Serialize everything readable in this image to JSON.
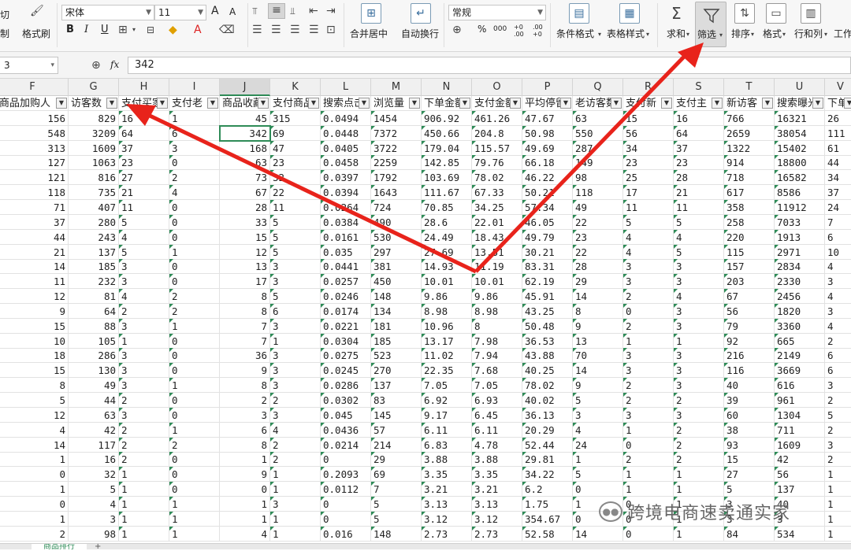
{
  "ribbon": {
    "cut_label": "切",
    "copy_label": "制",
    "format_painter": "格式刷",
    "font_name": "宋体",
    "font_size": "11",
    "number_format": "常规",
    "merge_center": "合并居中",
    "wrap_text": "自动换行",
    "conditional_format": "条件格式",
    "table_style": "表格样式",
    "sum": "求和",
    "filter": "筛选",
    "sort": "排序",
    "format": "格式",
    "row_col": "行和列",
    "work": "工作",
    "bold": "B",
    "italic": "I",
    "underline": "U",
    "font_grow": "A",
    "font_shrink": "A",
    "percent": "%",
    "thousand": "000",
    "inc_dec": "+0 .00",
    "dec_dec": ".00 +0"
  },
  "formula_bar": {
    "name_box": "3",
    "fx": "fx",
    "value": "342"
  },
  "columns": [
    "F",
    "G",
    "H",
    "I",
    "J",
    "K",
    "L",
    "M",
    "N",
    "O",
    "P",
    "Q",
    "R",
    "S",
    "T",
    "U",
    "V"
  ],
  "headers": [
    "商品加购人",
    "访客数",
    "支付买家",
    "支付老",
    "商品收藏",
    "支付商品",
    "搜索点击",
    "浏览量",
    "下单金额",
    "支付金额",
    "平均停留",
    "老访客数",
    "支付新",
    "支付主",
    "新访客",
    "搜索曝光",
    "下单"
  ],
  "rows": [
    [
      "156",
      "829",
      "16",
      "1",
      "45",
      "315",
      "0.0494",
      "1454",
      "906.92",
      "461.26",
      "47.67",
      "63",
      "15",
      "16",
      "766",
      "16321",
      "26"
    ],
    [
      "548",
      "3209",
      "64",
      "6",
      "342",
      "69",
      "0.0448",
      "7372",
      "450.66",
      "204.8",
      "50.98",
      "550",
      "56",
      "64",
      "2659",
      "38054",
      "111"
    ],
    [
      "313",
      "1609",
      "37",
      "3",
      "168",
      "47",
      "0.0405",
      "3722",
      "179.04",
      "115.57",
      "49.69",
      "287",
      "34",
      "37",
      "1322",
      "15402",
      "61"
    ],
    [
      "127",
      "1063",
      "23",
      "0",
      "63",
      "23",
      "0.0458",
      "2259",
      "142.85",
      "79.76",
      "66.18",
      "149",
      "23",
      "23",
      "914",
      "18800",
      "44"
    ],
    [
      "121",
      "816",
      "27",
      "2",
      "73",
      "32",
      "0.0397",
      "1792",
      "103.69",
      "78.02",
      "46.22",
      "98",
      "25",
      "28",
      "718",
      "16582",
      "34"
    ],
    [
      "118",
      "735",
      "21",
      "4",
      "67",
      "22",
      "0.0394",
      "1643",
      "111.67",
      "67.33",
      "50.21",
      "118",
      "17",
      "21",
      "617",
      "8586",
      "37"
    ],
    [
      "71",
      "407",
      "11",
      "0",
      "28",
      "11",
      "0.0264",
      "724",
      "70.85",
      "34.25",
      "57.34",
      "49",
      "11",
      "11",
      "358",
      "11912",
      "24"
    ],
    [
      "37",
      "280",
      "5",
      "0",
      "33",
      "5",
      "0.0384",
      "490",
      "28.6",
      "22.01",
      "46.05",
      "22",
      "5",
      "5",
      "258",
      "7033",
      "7"
    ],
    [
      "44",
      "243",
      "4",
      "0",
      "15",
      "5",
      "0.0161",
      "530",
      "24.49",
      "18.43",
      "49.79",
      "23",
      "4",
      "4",
      "220",
      "1913",
      "6"
    ],
    [
      "21",
      "137",
      "5",
      "1",
      "12",
      "5",
      "0.035",
      "297",
      "27.69",
      "13.51",
      "30.21",
      "22",
      "4",
      "5",
      "115",
      "2971",
      "10"
    ],
    [
      "14",
      "185",
      "3",
      "0",
      "13",
      "3",
      "0.0441",
      "381",
      "14.93",
      "11.19",
      "83.31",
      "28",
      "3",
      "3",
      "157",
      "2834",
      "4"
    ],
    [
      "11",
      "232",
      "3",
      "0",
      "17",
      "3",
      "0.0257",
      "450",
      "10.01",
      "10.01",
      "62.19",
      "29",
      "3",
      "3",
      "203",
      "2330",
      "3"
    ],
    [
      "12",
      "81",
      "4",
      "2",
      "8",
      "5",
      "0.0246",
      "148",
      "9.86",
      "9.86",
      "45.91",
      "14",
      "2",
      "4",
      "67",
      "2456",
      "4"
    ],
    [
      "9",
      "64",
      "2",
      "2",
      "8",
      "6",
      "0.0174",
      "134",
      "8.98",
      "8.98",
      "43.25",
      "8",
      "0",
      "3",
      "56",
      "1820",
      "3"
    ],
    [
      "15",
      "88",
      "3",
      "1",
      "7",
      "3",
      "0.0221",
      "181",
      "10.96",
      "8",
      "50.48",
      "9",
      "2",
      "3",
      "79",
      "3360",
      "4"
    ],
    [
      "10",
      "105",
      "1",
      "0",
      "7",
      "1",
      "0.0304",
      "185",
      "13.17",
      "7.98",
      "36.53",
      "13",
      "1",
      "1",
      "92",
      "665",
      "2"
    ],
    [
      "18",
      "286",
      "3",
      "0",
      "36",
      "3",
      "0.0275",
      "523",
      "11.02",
      "7.94",
      "43.88",
      "70",
      "3",
      "3",
      "216",
      "2149",
      "6"
    ],
    [
      "15",
      "130",
      "3",
      "0",
      "9",
      "3",
      "0.0245",
      "270",
      "22.35",
      "7.68",
      "40.25",
      "14",
      "3",
      "3",
      "116",
      "3669",
      "6"
    ],
    [
      "8",
      "49",
      "3",
      "1",
      "8",
      "3",
      "0.0286",
      "137",
      "7.05",
      "7.05",
      "78.02",
      "9",
      "2",
      "3",
      "40",
      "616",
      "3"
    ],
    [
      "5",
      "44",
      "2",
      "0",
      "2",
      "2",
      "0.0302",
      "83",
      "6.92",
      "6.93",
      "40.02",
      "5",
      "2",
      "2",
      "39",
      "961",
      "2"
    ],
    [
      "12",
      "63",
      "3",
      "0",
      "3",
      "3",
      "0.045",
      "145",
      "9.17",
      "6.45",
      "36.13",
      "3",
      "3",
      "3",
      "60",
      "1304",
      "5"
    ],
    [
      "4",
      "42",
      "2",
      "1",
      "6",
      "4",
      "0.0436",
      "57",
      "6.11",
      "6.11",
      "20.29",
      "4",
      "1",
      "2",
      "38",
      "711",
      "2"
    ],
    [
      "14",
      "117",
      "2",
      "2",
      "8",
      "2",
      "0.0214",
      "214",
      "6.83",
      "4.78",
      "52.44",
      "24",
      "0",
      "2",
      "93",
      "1609",
      "3"
    ],
    [
      "1",
      "16",
      "2",
      "0",
      "1",
      "2",
      "0",
      "29",
      "3.88",
      "3.88",
      "29.81",
      "1",
      "2",
      "2",
      "15",
      "42",
      "2"
    ],
    [
      "0",
      "32",
      "1",
      "0",
      "9",
      "1",
      "0.2093",
      "69",
      "3.35",
      "3.35",
      "34.22",
      "5",
      "1",
      "1",
      "27",
      "56",
      "1"
    ],
    [
      "1",
      "5",
      "1",
      "0",
      "0",
      "1",
      "0.0112",
      "7",
      "3.21",
      "3.21",
      "6.2",
      "0",
      "1",
      "1",
      "5",
      "137",
      "1"
    ],
    [
      "0",
      "4",
      "1",
      "1",
      "1",
      "3",
      "0",
      "5",
      "3.13",
      "3.13",
      "1.75",
      "1",
      "0",
      "1",
      "3",
      "40",
      "1"
    ],
    [
      "1",
      "3",
      "1",
      "1",
      "1",
      "1",
      "0",
      "5",
      "3.12",
      "3.12",
      "354.67",
      "0",
      "0",
      "1",
      "3",
      "3",
      "1"
    ],
    [
      "2",
      "98",
      "1",
      "1",
      "4",
      "1",
      "0.016",
      "148",
      "2.73",
      "2.73",
      "52.58",
      "14",
      "0",
      "1",
      "84",
      "534",
      "1"
    ]
  ],
  "selected_cell": "J3",
  "sheet_tab": "商品排行",
  "watermark": "跨境电商速卖通实家",
  "colors": {
    "accent": "#2e8b57",
    "arrow": "#e8231b"
  }
}
